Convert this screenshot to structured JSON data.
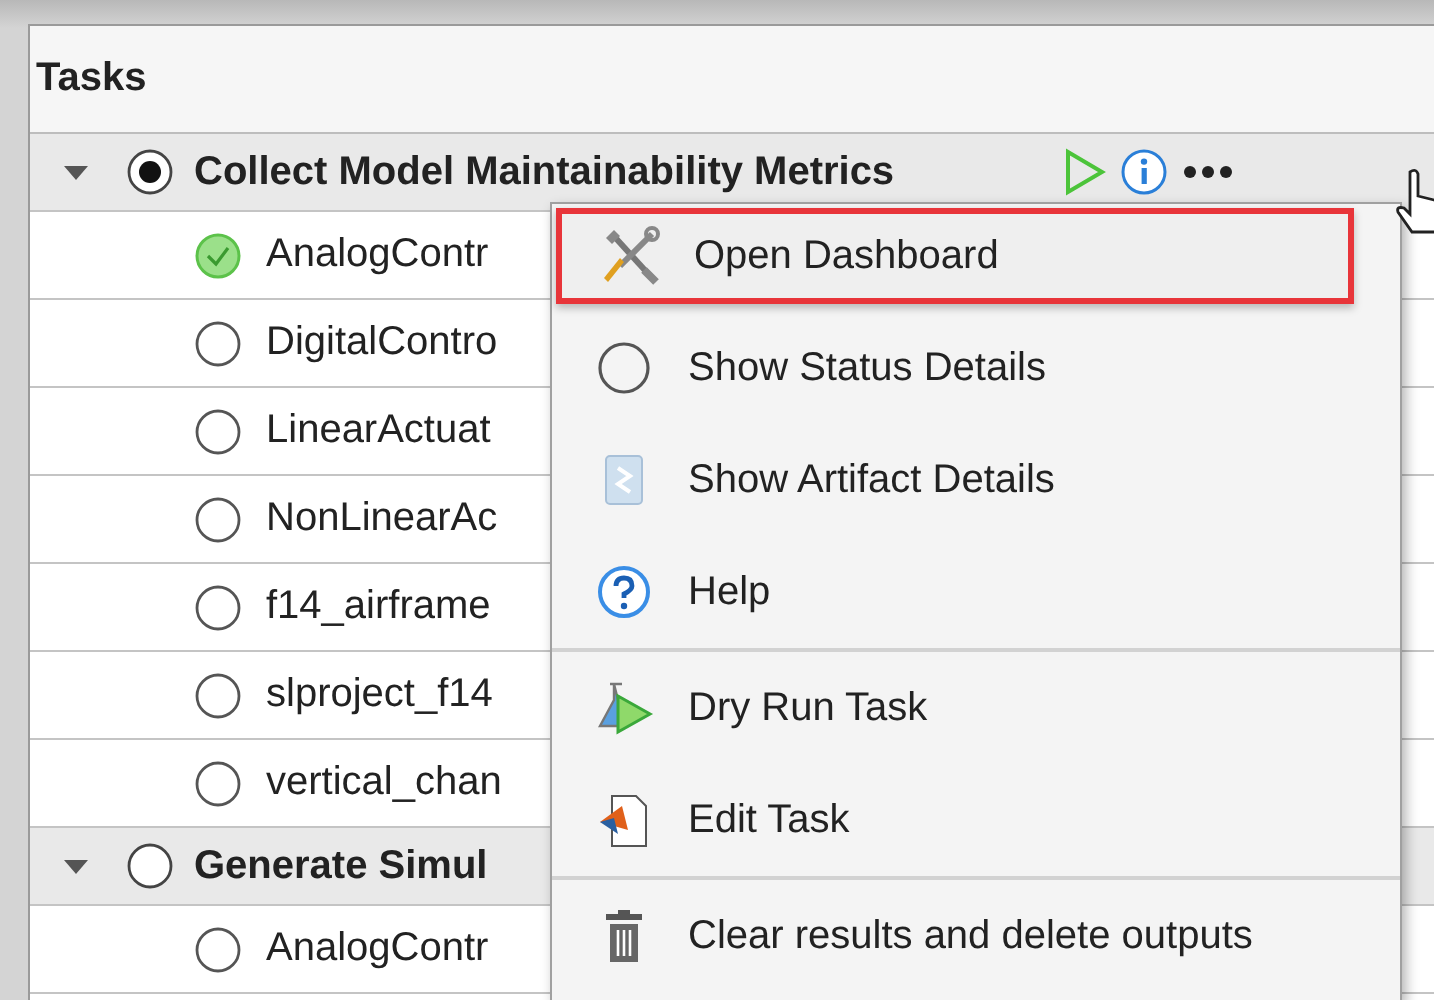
{
  "panel": {
    "title": "Tasks"
  },
  "tasks": [
    {
      "name": "Collect Model Maintainability Metrics",
      "expanded": true,
      "selected": true,
      "children": [
        {
          "name": "AnalogContr",
          "passed": true
        },
        {
          "name": "DigitalContro",
          "passed": false
        },
        {
          "name": "LinearActuat",
          "passed": false
        },
        {
          "name": "NonLinearAc",
          "passed": false
        },
        {
          "name": "f14_airframe",
          "passed": false
        },
        {
          "name": "slproject_f14",
          "passed": false
        },
        {
          "name": "vertical_chan",
          "passed": false
        }
      ]
    },
    {
      "name": "Generate Simul",
      "expanded": true,
      "selected": false,
      "children": [
        {
          "name": "AnalogContr",
          "passed": false
        }
      ]
    }
  ],
  "context_menu": {
    "sections": [
      [
        {
          "label": "Open Dashboard",
          "kind": "tools",
          "highlighted": true
        },
        {
          "label": "Show Status Details",
          "kind": "status",
          "highlighted": false
        },
        {
          "label": "Show Artifact Details",
          "kind": "artifact",
          "highlighted": false
        },
        {
          "label": "Help",
          "kind": "help",
          "highlighted": false
        }
      ],
      [
        {
          "label": "Dry Run Task",
          "kind": "dryrun",
          "highlighted": false
        },
        {
          "label": "Edit Task",
          "kind": "edit",
          "highlighted": false
        }
      ],
      [
        {
          "label": "Clear results and delete outputs",
          "kind": "delete",
          "highlighted": false
        }
      ]
    ]
  }
}
